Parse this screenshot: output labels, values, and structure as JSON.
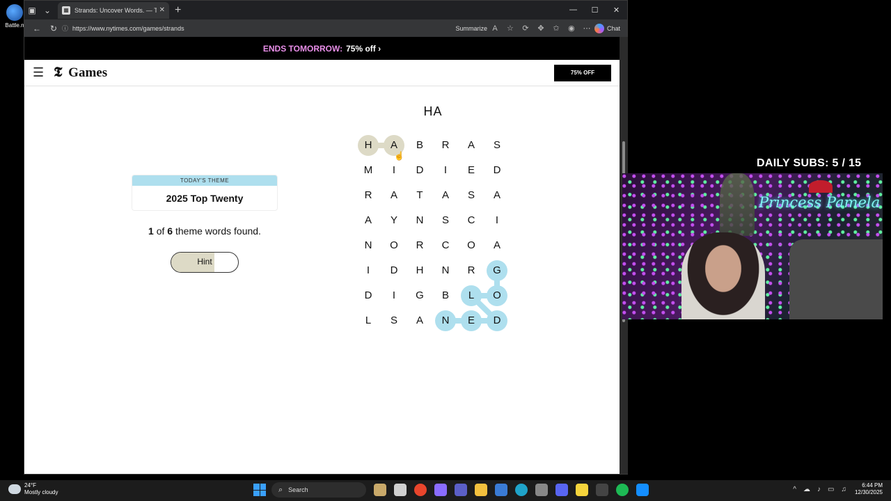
{
  "desktop": {
    "icon_label": "Battle.n"
  },
  "browser": {
    "tab_title": "Strands: Uncover Words. — The N",
    "url": "https://www.nytimes.com/games/strands",
    "summarize_label": "Summarize",
    "chat_label": "Chat"
  },
  "promo": {
    "ends": "ENDS TOMORROW:",
    "offer": "75% off ›"
  },
  "header": {
    "logo_mark": "𝕿",
    "logo_text": "Games",
    "subscribe": "75% OFF"
  },
  "game": {
    "current_word": "HA",
    "theme_caption": "TODAY'S THEME",
    "theme_name": "2025 Top Twenty",
    "found_count": "1",
    "found_of": "of",
    "found_total": "6",
    "found_suffix": "theme words found.",
    "hint_label": "Hint",
    "hint_progress": 0.65,
    "grid": [
      [
        "H",
        "A",
        "B",
        "R",
        "A",
        "S"
      ],
      [
        "M",
        "I",
        "D",
        "I",
        "E",
        "D"
      ],
      [
        "R",
        "A",
        "T",
        "A",
        "S",
        "A"
      ],
      [
        "A",
        "Y",
        "N",
        "S",
        "C",
        "I"
      ],
      [
        "N",
        "O",
        "R",
        "C",
        "O",
        "A"
      ],
      [
        "I",
        "D",
        "H",
        "N",
        "R",
        "G"
      ],
      [
        "D",
        "I",
        "G",
        "B",
        "L",
        "O"
      ],
      [
        "L",
        "S",
        "A",
        "N",
        "E",
        "D"
      ]
    ],
    "selected_path": [
      [
        0,
        0
      ],
      [
        0,
        1
      ]
    ],
    "found_path": [
      [
        5,
        5
      ],
      [
        6,
        5
      ],
      [
        6,
        4
      ],
      [
        7,
        5
      ],
      [
        7,
        4
      ],
      [
        7,
        3
      ]
    ],
    "colors": {
      "selected": "#dddac6",
      "found": "#aedfee"
    }
  },
  "stream": {
    "subs_label": "DAILY SUBS:  5 / 15",
    "neon_text": "Princess Pamela"
  },
  "taskbar": {
    "temp": "24°F",
    "condition": "Mostly cloudy",
    "search_label": "Search",
    "time": "6:44 PM",
    "date": "12/30/2025"
  }
}
